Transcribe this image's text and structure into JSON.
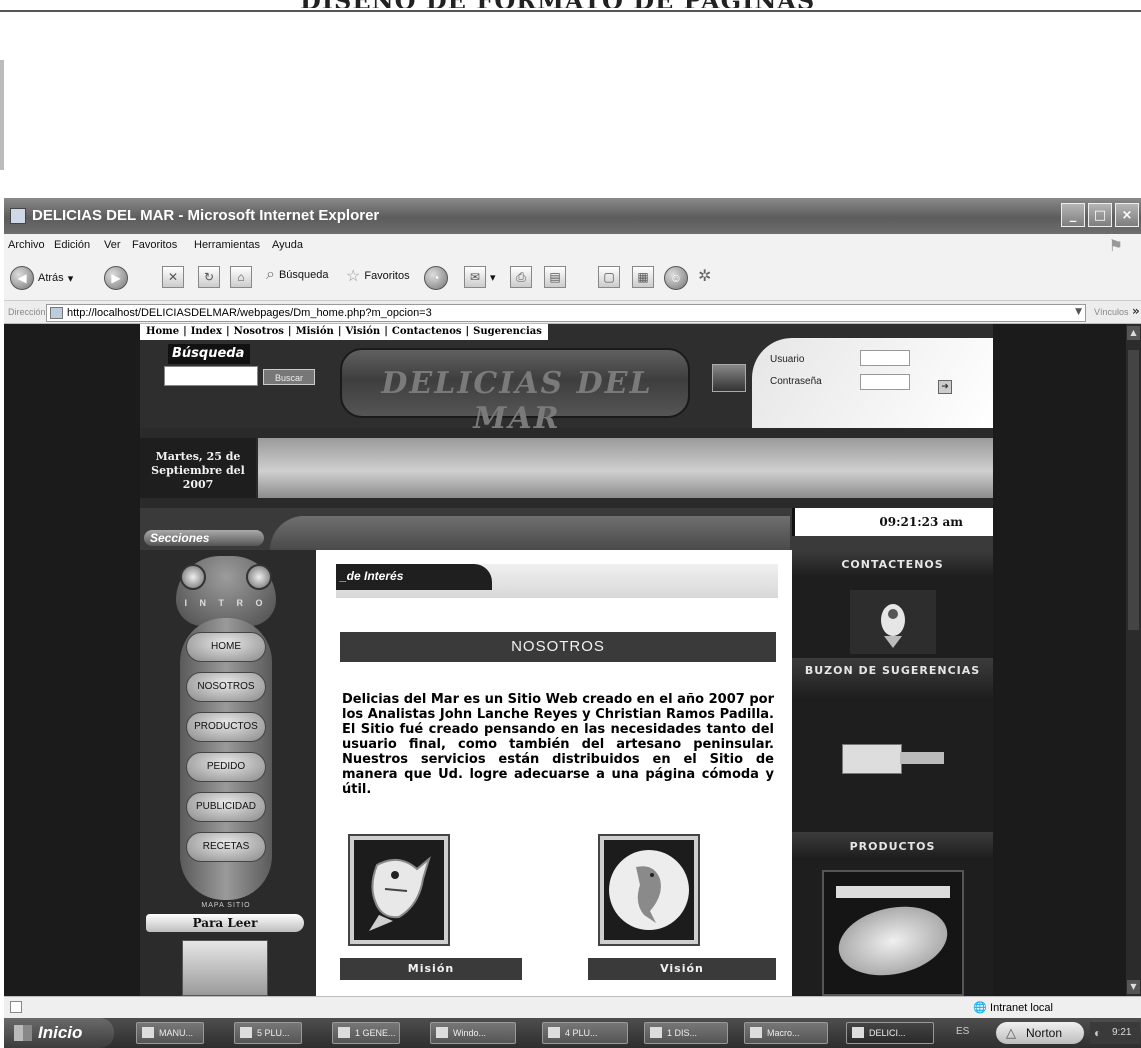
{
  "document": {
    "heading": "DISEÑO DE FORMATO DE PÁGINAS"
  },
  "window": {
    "title": "DELICIAS DEL MAR - Microsoft Internet Explorer",
    "menu": [
      "Archivo",
      "Edición",
      "Ver",
      "Favoritos",
      "Herramientas",
      "Ayuda"
    ],
    "toolbar": {
      "back": "Atrás",
      "search": "Búsqueda",
      "favorites": "Favoritos"
    },
    "address_label": "Dirección",
    "url": "http://localhost/DELICIASDELMAR/webpages/Dm_home.php?m_opcion=3",
    "links_label": "Vínculos",
    "status_zone": "Intranet local"
  },
  "site": {
    "topnav": [
      "Home",
      "Index",
      "Nosotros",
      "Misión",
      "Visión",
      "Contactenos",
      "Sugerencias"
    ],
    "search_label": "Búsqueda",
    "search_button": "Buscar",
    "banner": "DELICIAS DEL MAR",
    "login": {
      "user_label": "Usuario",
      "password_label": "Contraseña"
    },
    "date": "Martes, 25 de Septiembre del 2007",
    "sections_label": "Secciones",
    "clock": "09:21:23 am",
    "left_menu": {
      "intro": "I N T R O",
      "items": [
        "HOME",
        "NOSOTROS",
        "PRODUCTOS",
        "PEDIDO",
        "PUBLICIDAD",
        "RECETAS"
      ],
      "map": "MAPA SITIO",
      "para_leer": "Para Leer"
    },
    "center": {
      "interes_tab": "_de Interés",
      "section_title": "NOSOTROS",
      "about": "Delicias del Mar es un Sitio Web creado en el año 2007 por los Analistas John Lanche Reyes y Christian Ramos Padilla. El Sitio fué creado pensando en las necesidades tanto del usuario final, como también del artesano peninsular. Nuestros servicios están distribuidos en el Sitio de manera que Ud. logre adecuarse a una página cómoda y útil.",
      "mision": "Misión",
      "vision": "Visión"
    },
    "right": {
      "contactenos": "CONTACTENOS",
      "buzon": "BUZON DE SUGERENCIAS",
      "productos": "PRODUCTOS"
    }
  },
  "taskbar": {
    "start": "Inicio",
    "tasks": [
      "MANU...",
      "5 PLU...",
      "1 GENE...",
      "Windo...",
      "4 PLU...",
      "1 DIS...",
      "Macro...",
      "DELICI..."
    ],
    "lang": "ES",
    "norton": "Norton",
    "clock": "9:21"
  }
}
